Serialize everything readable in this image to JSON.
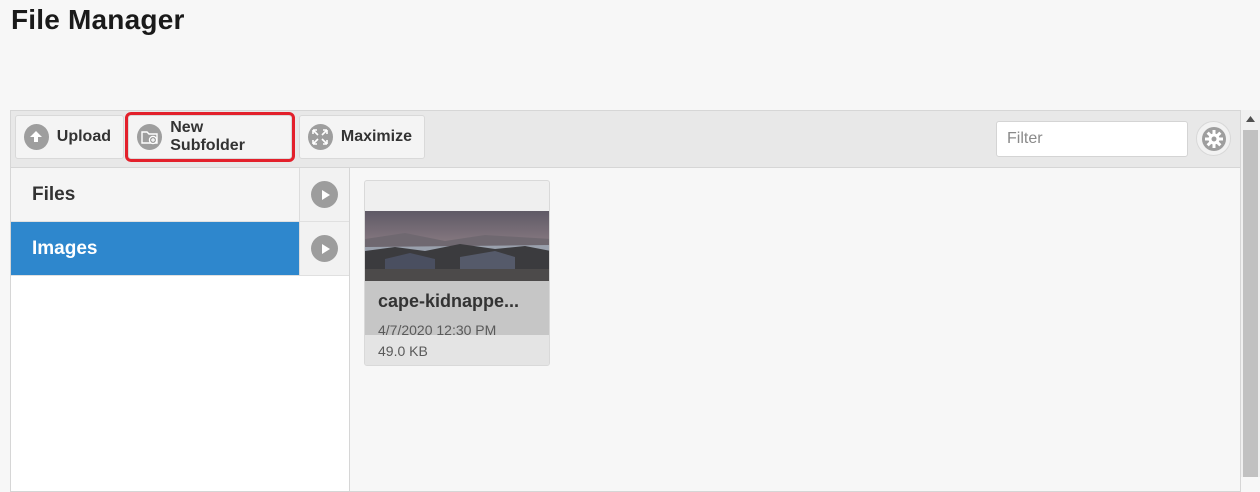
{
  "page": {
    "title": "File Manager"
  },
  "toolbar": {
    "upload_label": "Upload",
    "new_subfolder_label": "New Subfolder",
    "maximize_label": "Maximize",
    "filter_placeholder": "Filter",
    "highlight_color": "#e3202b"
  },
  "sidebar": {
    "items": [
      {
        "label": "Files",
        "active": false
      },
      {
        "label": "Images",
        "active": true
      }
    ],
    "active_color": "#2e87cd"
  },
  "files": [
    {
      "name": "cape-kidnappe...",
      "date": "4/7/2020 12:30 PM",
      "size": "49.0 KB"
    }
  ],
  "icons": {
    "upload": "upload-icon",
    "new_subfolder": "folder-plus-icon",
    "maximize": "maximize-icon",
    "settings": "gear-icon",
    "expand": "play-icon",
    "scroll_up": "scroll-up-arrow-icon"
  }
}
